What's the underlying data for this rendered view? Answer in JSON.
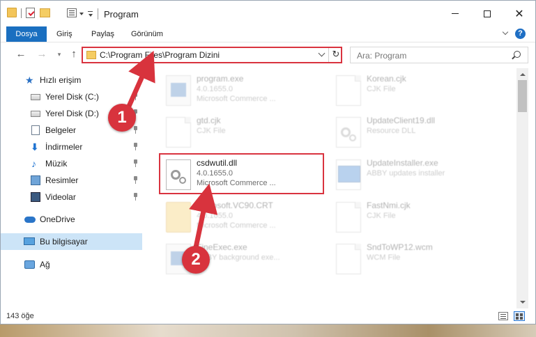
{
  "window": {
    "title": "Program"
  },
  "ribbon": {
    "tabs": [
      "Dosya",
      "Giriş",
      "Paylaş",
      "Görünüm"
    ],
    "help": "?"
  },
  "nav": {
    "address": "C:\\Program Files\\Program Dizini",
    "search_placeholder": "Ara: Program"
  },
  "sidebar": {
    "items": [
      {
        "label": "Hızlı erişim",
        "icon": "star-icon"
      },
      {
        "label": "Yerel Disk (C:)",
        "icon": "drive-icon"
      },
      {
        "label": "Yerel Disk (D:)",
        "icon": "drive-icon"
      },
      {
        "label": "Belgeler",
        "icon": "documents-icon"
      },
      {
        "label": "İndirmeler",
        "icon": "download-icon"
      },
      {
        "label": "Müzik",
        "icon": "music-icon"
      },
      {
        "label": "Resimler",
        "icon": "pictures-icon"
      },
      {
        "label": "Videolar",
        "icon": "videos-icon"
      },
      {
        "label": "OneDrive",
        "icon": "onedrive-icon"
      },
      {
        "label": "Bu bilgisayar",
        "icon": "computer-icon"
      },
      {
        "label": "Ağ",
        "icon": "network-icon"
      }
    ]
  },
  "files": [
    {
      "name": "program.exe",
      "line2": "4.0.1655.0",
      "line3": "Microsoft Commerce ...",
      "icon": "exe-file-icon"
    },
    {
      "name": "Korean.cjk",
      "line2": "CJK File",
      "line3": "",
      "icon": "generic-file-icon"
    },
    {
      "name": "gtd.cjk",
      "line2": "CJK File",
      "line3": "",
      "icon": "generic-file-icon"
    },
    {
      "name": "UpdateClient19.dll",
      "line2": "Resource DLL",
      "line3": "",
      "icon": "dll-file-icon"
    },
    {
      "name": "csdwutil.dll",
      "line2": "4.0.1655.0",
      "line3": "Microsoft Commerce ...",
      "icon": "dll-file-icon"
    },
    {
      "name": "UpdateInstaller.exe",
      "line2": "ABBY updates installer",
      "line3": "",
      "icon": "installer-icon"
    },
    {
      "name": "Microsoft.VC90.CRT",
      "line2": "4.0.1655.0",
      "line3": "Microsoft Commerce ...",
      "icon": "folder-icon"
    },
    {
      "name": "FastNmi.cjk",
      "line2": "CJK File",
      "line3": "",
      "icon": "generic-file-icon"
    },
    {
      "name": "FineExec.exe",
      "line2": "ABBY background exe...",
      "line3": "",
      "icon": "exe-file-icon"
    },
    {
      "name": "SndToWP12.wcm",
      "line2": "WCM File",
      "line3": "",
      "icon": "generic-file-icon"
    }
  ],
  "status": {
    "item_count": "143 öğe"
  },
  "callouts": [
    "1",
    "2"
  ]
}
